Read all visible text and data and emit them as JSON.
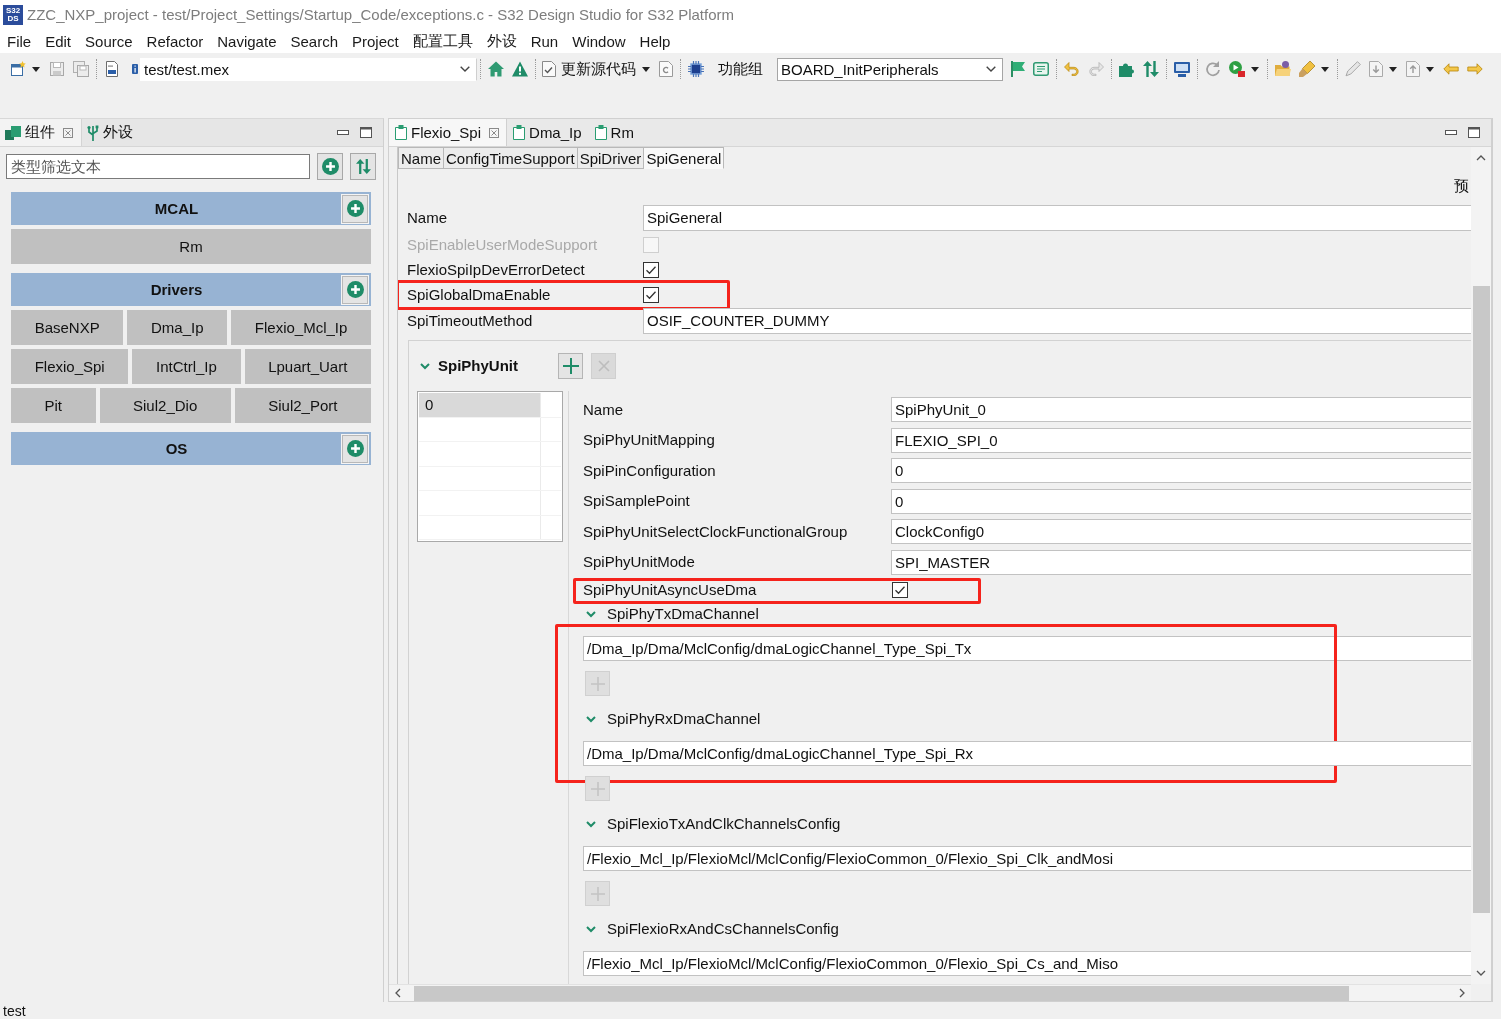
{
  "window": {
    "logo": [
      "S32",
      "DS"
    ],
    "title": "ZZC_NXP_project - test/Project_Settings/Startup_Code/exceptions.c - S32 Design Studio for S32 Platform"
  },
  "menu": [
    "File",
    "Edit",
    "Source",
    "Refactor",
    "Navigate",
    "Search",
    "Project",
    "配置工具",
    "外设",
    "Run",
    "Window",
    "Help"
  ],
  "toolbar": {
    "config_file": "test/test.mex",
    "update_button": "更新源代码",
    "group_label": "功能组",
    "group_value": "BOARD_InitPeripherals"
  },
  "left_panel": {
    "tabs": [
      {
        "label": "组件",
        "selected": true
      },
      {
        "label": "外设",
        "selected": false
      }
    ],
    "filter": {
      "placeholder": "类型筛选文本"
    },
    "groups": [
      {
        "name": "MCAL",
        "rows": [
          [
            "Rm"
          ]
        ]
      },
      {
        "name": "Drivers",
        "rows": [
          [
            "BaseNXP",
            "Dma_Ip",
            "Flexio_Mcl_Ip"
          ],
          [
            "Flexio_Spi",
            "IntCtrl_Ip",
            "Lpuart_Uart"
          ],
          [
            "Pit",
            "Siul2_Dio",
            "Siul2_Port"
          ]
        ]
      },
      {
        "name": "OS"
      }
    ]
  },
  "editor": {
    "tabs": [
      {
        "label": "Flexio_Spi",
        "selected": true
      },
      {
        "label": "Dma_Ip",
        "selected": false
      },
      {
        "label": "Rm",
        "selected": false
      }
    ],
    "sections": [
      {
        "label": "Name",
        "selected": false
      },
      {
        "label": "ConfigTimeSupport",
        "selected": false
      },
      {
        "label": "SpiDriver",
        "selected": false
      },
      {
        "label": "SpiGeneral",
        "selected": true
      }
    ],
    "preset": "预",
    "general": {
      "fields": [
        {
          "kind": "text",
          "label": "Name",
          "value": "SpiGeneral",
          "disabled": false,
          "highlighted": false
        },
        {
          "kind": "checkbox",
          "label": "SpiEnableUserModeSupport",
          "checked": false,
          "disabled": true,
          "highlighted": false
        },
        {
          "kind": "checkbox",
          "label": "FlexioSpiIpDevErrorDetect",
          "checked": true,
          "disabled": false,
          "highlighted": false
        },
        {
          "kind": "checkbox",
          "label": "SpiGlobalDmaEnable",
          "checked": true,
          "disabled": false,
          "highlighted": true
        },
        {
          "kind": "text",
          "label": "SpiTimeoutMethod",
          "value": "OSIF_COUNTER_DUMMY",
          "disabled": false,
          "highlighted": false
        }
      ]
    },
    "phy_unit": {
      "title": "SpiPhyUnit",
      "expanded": true,
      "buttons": [
        {
          "kind": "add",
          "disabled": false
        },
        {
          "kind": "remove",
          "disabled": true
        }
      ],
      "instances": [
        {
          "label": "0",
          "selected": true
        }
      ],
      "fields": [
        {
          "kind": "text",
          "label": "Name",
          "value": "SpiPhyUnit_0",
          "highlighted": false
        },
        {
          "kind": "text",
          "label": "SpiPhyUnitMapping",
          "value": "FLEXIO_SPI_0",
          "highlighted": false
        },
        {
          "kind": "text",
          "label": "SpiPinConfiguration",
          "value": "0",
          "highlighted": false
        },
        {
          "kind": "text",
          "label": "SpiSamplePoint",
          "value": "0",
          "highlighted": false
        },
        {
          "kind": "text",
          "label": "SpiPhyUnitSelectClockFunctionalGroup",
          "value": "ClockConfig0",
          "highlighted": false
        },
        {
          "kind": "text",
          "label": "SpiPhyUnitMode",
          "value": "SPI_MASTER",
          "highlighted": false
        },
        {
          "kind": "checkbox",
          "label": "SpiPhyUnitAsyncUseDma",
          "checked": true,
          "highlighted": true
        }
      ],
      "channels": [
        {
          "label": "SpiPhyTxDmaChannel",
          "expanded": true,
          "value": "/Dma_Ip/Dma/MclConfig/dmaLogicChannel_Type_Spi_Tx",
          "add_button": {
            "disabled": true
          },
          "highlighted": true
        },
        {
          "label": "SpiPhyRxDmaChannel",
          "expanded": true,
          "value": "/Dma_Ip/Dma/MclConfig/dmaLogicChannel_Type_Spi_Rx",
          "add_button": {
            "disabled": true
          },
          "highlighted": true
        },
        {
          "label": "SpiFlexioTxAndClkChannelsConfig",
          "expanded": true,
          "value": "/Flexio_Mcl_Ip/FlexioMcl/MclConfig/FlexioCommon_0/Flexio_Spi_Clk_andMosi",
          "add_button": {
            "disabled": true
          },
          "highlighted": false
        },
        {
          "label": "SpiFlexioRxAndCsChannelsConfig",
          "expanded": true,
          "value": "/Flexio_Mcl_Ip/FlexioMcl/MclConfig/FlexioCommon_0/Flexio_Spi_Cs_and_Miso",
          "highlighted": false
        }
      ]
    }
  },
  "status_bar": {
    "text": "test"
  }
}
